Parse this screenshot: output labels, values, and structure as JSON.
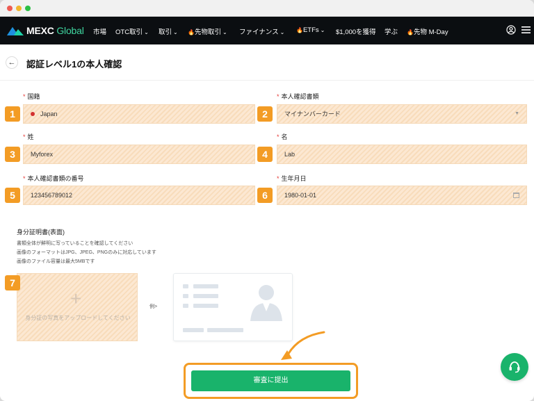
{
  "nav": {
    "logo_main": "MEXC",
    "logo_sub": "Global",
    "items": {
      "market": "市場",
      "otc": "OTC取引",
      "trade": "取引",
      "futures": "先物取引",
      "finance": "ファイナンス",
      "etfs": "ETFs",
      "reward": "$1,000を獲得",
      "learn": "学ぶ",
      "mday": "先物 M-Day"
    }
  },
  "page": {
    "title": "認証レベル1の本人確認"
  },
  "form": {
    "nationality": {
      "label": "国籍",
      "value": "Japan"
    },
    "id_type": {
      "label": "本人確認書類",
      "value": "マイナンバーカード"
    },
    "last_name": {
      "label": "姓",
      "value": "Myforex"
    },
    "first_name": {
      "label": "名",
      "value": "Lab"
    },
    "id_number": {
      "label": "本人確認書類の番号",
      "value": "123456789012"
    },
    "birthdate": {
      "label": "生年月日",
      "value": "1980-01-01"
    },
    "required_mark": "*"
  },
  "upload": {
    "title": "身分証明書(表面)",
    "notes": [
      "書類全体が鮮明に写っていることを確認してください",
      "画像のフォーマットはJPG、JPEG、PNGのみに対応しています",
      "画像のファイル容量は最大5MBです"
    ],
    "placeholder": "身分証の写真をアップロードしてください",
    "example_label": "例>"
  },
  "badges": [
    "1",
    "2",
    "3",
    "4",
    "5",
    "6",
    "7"
  ],
  "submit": {
    "label": "審査に提出"
  },
  "colors": {
    "brand_green": "#19b36b",
    "annotation_orange": "#f39c25",
    "nav_bg": "#0b0e11",
    "required_red": "#e53935"
  }
}
